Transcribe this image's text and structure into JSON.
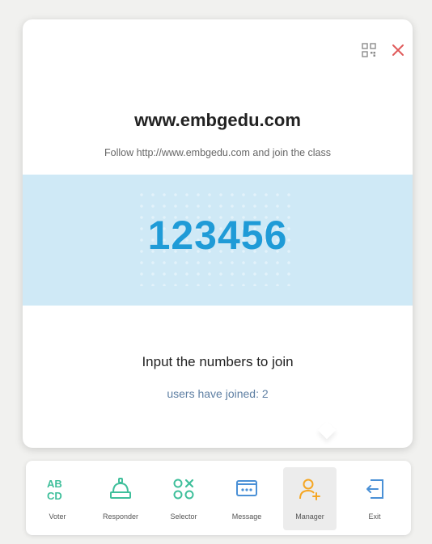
{
  "popup": {
    "title": "www.embgedu.com",
    "subtitle": "Follow http://www.embgedu.com and join the class",
    "class_code": "123456",
    "input_hint": "Input the numbers to join",
    "joined_status": "users have joined: 2"
  },
  "toolbar": {
    "tools": [
      {
        "label": "Voter",
        "icon": "abcd-icon"
      },
      {
        "label": "Responder",
        "icon": "buzzer-icon"
      },
      {
        "label": "Selector",
        "icon": "selector-icon"
      },
      {
        "label": "Message",
        "icon": "message-icon"
      },
      {
        "label": "Manager",
        "icon": "add-user-icon",
        "active": true
      },
      {
        "label": "Exit",
        "icon": "exit-icon"
      }
    ]
  },
  "colors": {
    "accent_blue": "#1f9bd7",
    "band_blue": "#cfe9f6",
    "tool_green": "#3fbf9b",
    "tool_blue": "#4a90d6",
    "tool_orange": "#f5a623",
    "close_red": "#e05a5a"
  }
}
